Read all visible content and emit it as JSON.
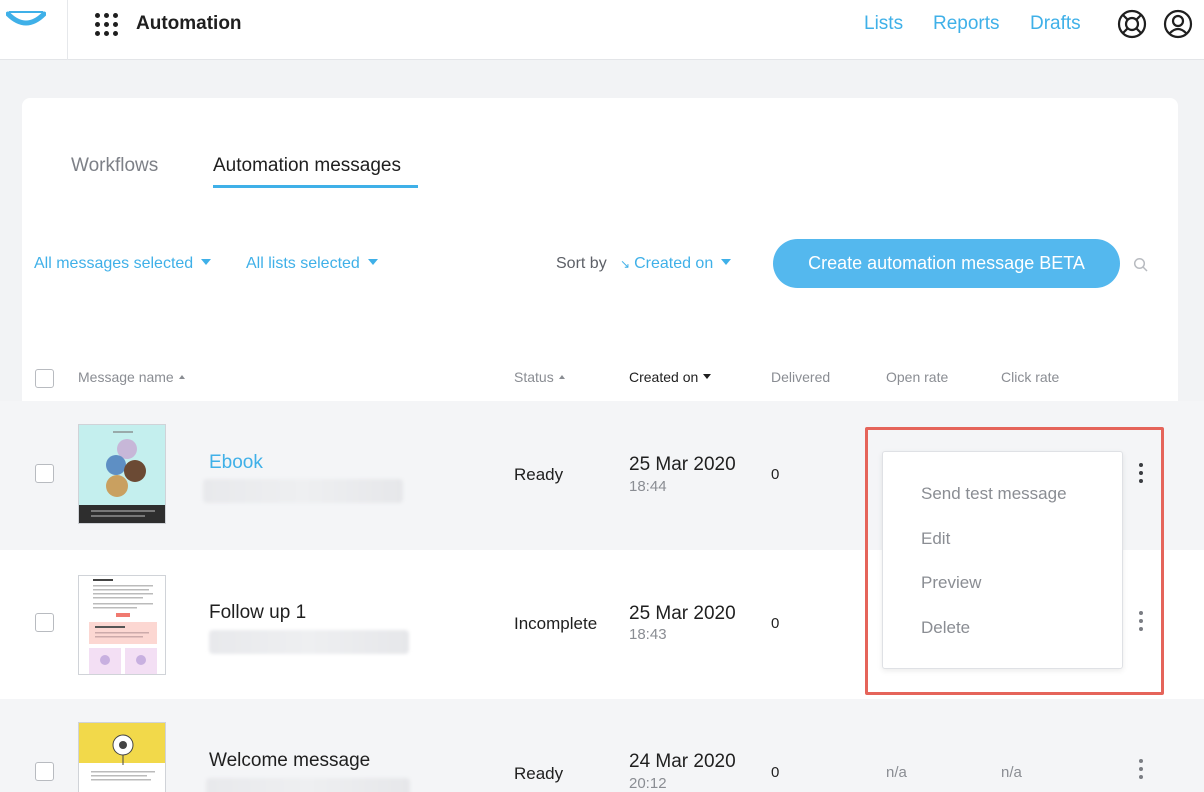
{
  "header": {
    "app_title": "Automation",
    "nav": [
      "Lists",
      "Reports",
      "Drafts"
    ],
    "accent": "#3fb0e8"
  },
  "tabs": [
    {
      "label": "Workflows",
      "active": false
    },
    {
      "label": "Automation messages",
      "active": true
    }
  ],
  "filters": {
    "messages": "All messages selected",
    "lists": "All lists selected",
    "sort_label": "Sort by",
    "sort_value": "Created on"
  },
  "create_button": "Create automation message BETA",
  "table": {
    "headers": {
      "name": "Message name",
      "status": "Status",
      "created": "Created on",
      "delivered": "Delivered",
      "open_rate": "Open rate",
      "click_rate": "Click rate"
    },
    "rows": [
      {
        "name": "Ebook",
        "status": "Ready",
        "date": "25 Mar 2020",
        "time": "18:44",
        "delivered": "0",
        "open_rate": "",
        "click_rate": ""
      },
      {
        "name": "Follow up 1",
        "status": "Incomplete",
        "date": "25 Mar 2020",
        "time": "18:43",
        "delivered": "0",
        "open_rate": "",
        "click_rate": ""
      },
      {
        "name": "Welcome message",
        "status": "Ready",
        "date": "24 Mar 2020",
        "time": "20:12",
        "delivered": "0",
        "open_rate": "n/a",
        "click_rate": "n/a"
      }
    ]
  },
  "context_menu": {
    "items": [
      "Send test message",
      "Edit",
      "Preview",
      "Delete"
    ],
    "highlight_color": "#e5645a"
  }
}
